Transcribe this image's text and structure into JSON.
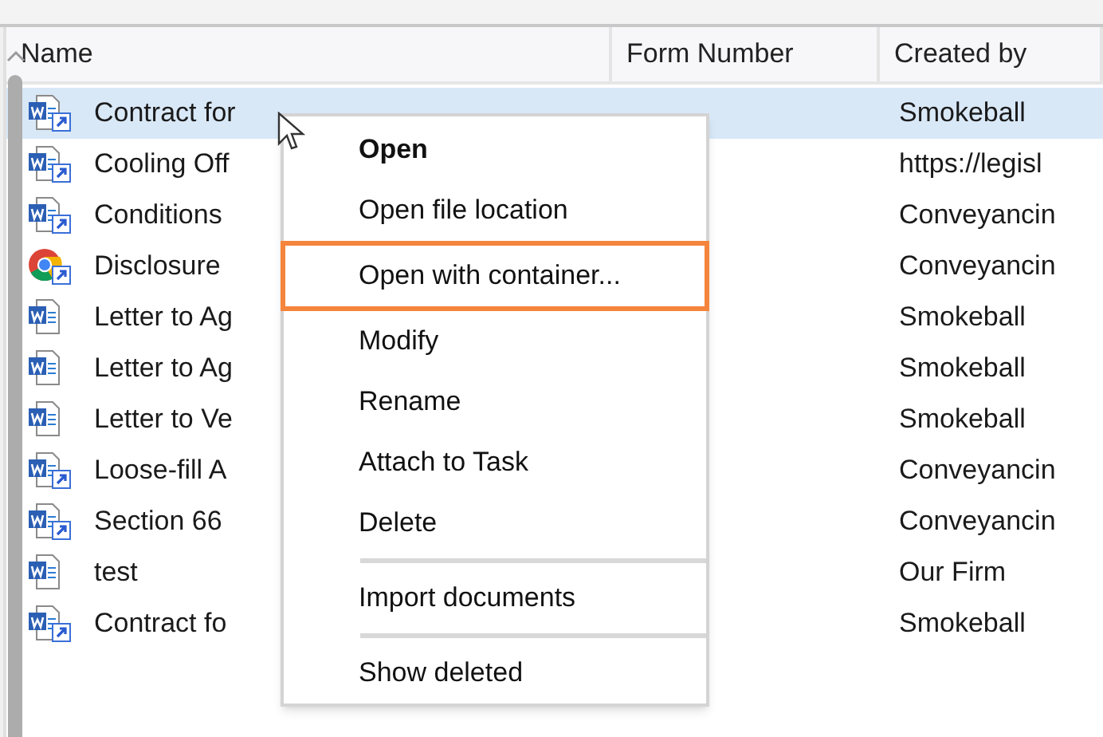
{
  "columns": [
    "Name",
    "Form Number",
    "Created by"
  ],
  "rows": [
    {
      "name": "Contract for",
      "created_by": "Smokeball",
      "kind": "word",
      "shortcut": true,
      "selected": true
    },
    {
      "name": "Cooling Off",
      "created_by": "https://legisl",
      "kind": "word",
      "shortcut": true,
      "selected": false
    },
    {
      "name": "Conditions",
      "created_by": "Conveyancin",
      "kind": "word",
      "shortcut": true,
      "selected": false
    },
    {
      "name": "Disclosure",
      "created_by": "Conveyancin",
      "kind": "chrome",
      "shortcut": true,
      "selected": false
    },
    {
      "name": "Letter to Ag",
      "created_by": "Smokeball",
      "kind": "word",
      "shortcut": false,
      "selected": false
    },
    {
      "name": "Letter to Ag",
      "created_by": "Smokeball",
      "kind": "word",
      "shortcut": false,
      "selected": false
    },
    {
      "name": "Letter to Ve",
      "created_by": "Smokeball",
      "kind": "word",
      "shortcut": false,
      "selected": false
    },
    {
      "name": "Loose-fill A",
      "created_by": "Conveyancin",
      "kind": "word",
      "shortcut": true,
      "selected": false
    },
    {
      "name": "Section 66",
      "created_by": "Conveyancin",
      "kind": "word",
      "shortcut": true,
      "selected": false
    },
    {
      "name": "test",
      "created_by": "Our Firm",
      "kind": "word",
      "shortcut": false,
      "selected": false
    },
    {
      "name": "Contract fo",
      "created_by": "Smokeball",
      "kind": "word",
      "shortcut": true,
      "selected": false
    }
  ],
  "context_menu": [
    {
      "kind": "item",
      "label": "Open",
      "bold": true,
      "highlighted": false
    },
    {
      "kind": "item",
      "label": "Open file location",
      "bold": false,
      "highlighted": false
    },
    {
      "kind": "item",
      "label": "Open with container...",
      "bold": false,
      "highlighted": true
    },
    {
      "kind": "item",
      "label": "Modify",
      "bold": false,
      "highlighted": false
    },
    {
      "kind": "item",
      "label": "Rename",
      "bold": false,
      "highlighted": false
    },
    {
      "kind": "item",
      "label": "Attach to Task",
      "bold": false,
      "highlighted": false
    },
    {
      "kind": "item",
      "label": "Delete",
      "bold": false,
      "highlighted": false
    },
    {
      "kind": "separator"
    },
    {
      "kind": "item",
      "label": "Import documents",
      "bold": false,
      "highlighted": false
    },
    {
      "kind": "separator"
    },
    {
      "kind": "item",
      "label": "Show deleted",
      "bold": false,
      "highlighted": false
    }
  ]
}
